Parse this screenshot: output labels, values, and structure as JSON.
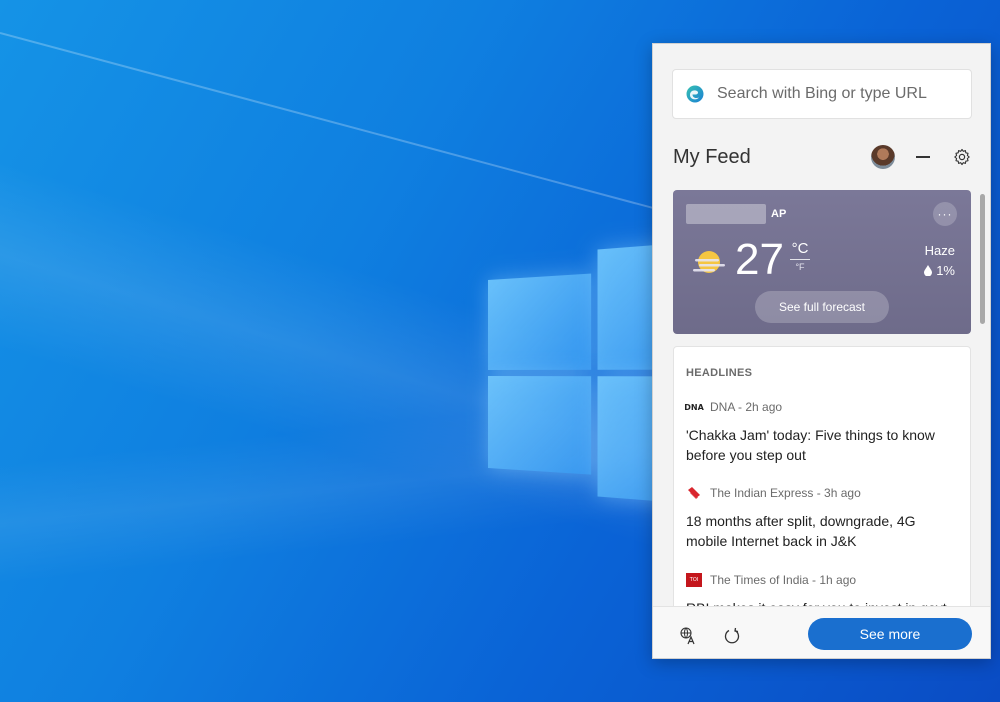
{
  "search": {
    "placeholder": "Search with Bing or type URL"
  },
  "feed": {
    "title": "My Feed"
  },
  "weather": {
    "location_state": "AP",
    "temperature": "27",
    "unit_celsius": "°C",
    "unit_fahrenheit": "°F",
    "condition": "Haze",
    "precipitation": "1%",
    "more_label": "···",
    "forecast_button": "See full forecast"
  },
  "news": {
    "section_label": "HEADLINES",
    "articles": [
      {
        "source": "DNA - 2h ago",
        "logo_text": "DNA",
        "title": "'Chakka Jam' today: Five things to know before you step out"
      },
      {
        "source": "The Indian Express - 3h ago",
        "title": "18 months after split, downgrade, 4G mobile Internet back in J&K"
      },
      {
        "source": "The Times of India - 1h ago",
        "logo_text": "TOI",
        "title": "RBI makes it easy for you to invest in govt"
      }
    ]
  },
  "footer": {
    "see_more": "See more"
  },
  "icons": [
    "edge-icon",
    "avatar",
    "minimize-icon",
    "gear-icon",
    "sun-icon",
    "drop-icon",
    "language-icon",
    "refresh-icon"
  ],
  "colors": {
    "accent": "#1a6fcf",
    "weather_card": "#7b7898",
    "desktop": "#0f7fe0"
  }
}
